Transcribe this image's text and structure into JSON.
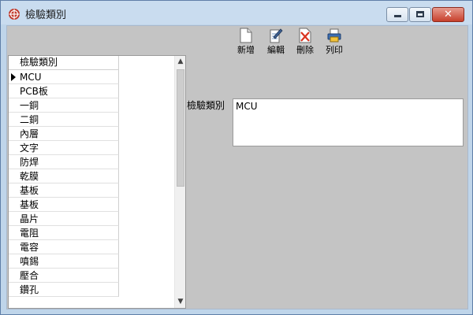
{
  "window": {
    "title": "檢驗類別",
    "close_glyph": "✕"
  },
  "toolbar": {
    "new_label": "新增",
    "edit_label": "編輯",
    "delete_label": "刪除",
    "print_label": "列印"
  },
  "grid": {
    "header": "檢驗類別",
    "rows": [
      "MCU",
      "PCB板",
      "一銅",
      "二銅",
      "內層",
      "文字",
      "防焊",
      "乾膜",
      "基板",
      "基板",
      "晶片",
      "電阻",
      "電容",
      "噴錫",
      "壓合",
      "鑽孔"
    ],
    "selected_index": 0
  },
  "form": {
    "label": "檢驗類別",
    "value": "MCU"
  },
  "colors": {
    "window_frame": "#5f7ea8",
    "client_bg": "#c4c4c4",
    "close_button": "#c7402c"
  }
}
